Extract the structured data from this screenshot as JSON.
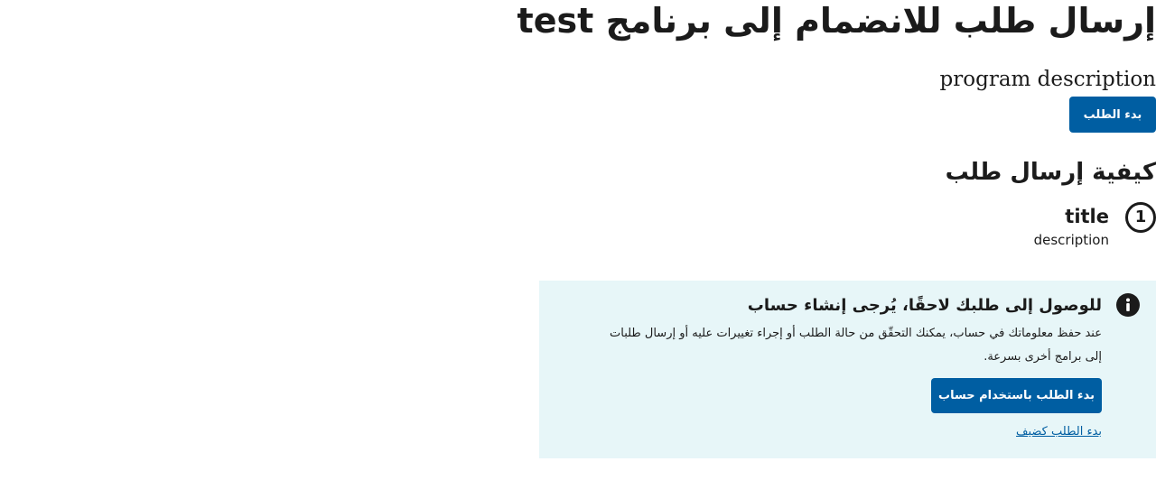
{
  "header": {
    "title": "إرسال طلب للانضمام إلى برنامج test",
    "program_description": "program description",
    "start_button_label": "بدء الطلب"
  },
  "how_to": {
    "heading": "كيفية إرسال طلب",
    "steps": [
      {
        "number": "1",
        "title": "title",
        "description": "description"
      }
    ]
  },
  "account_alert": {
    "icon": "info-icon",
    "heading": "للوصول إلى طلبك لاحقًا، يُرجى إنشاء حساب",
    "body": "عند حفظ معلوماتك في حساب، يمكنك التحقّق من حالة الطلب أو إجراء تغييرات عليه أو إرسال طلبات إلى برامج أخرى بسرعة.",
    "account_button_label": "بدء الطلب باستخدام حساب",
    "guest_link_label": "بدء الطلب كضيف"
  },
  "colors": {
    "primary": "#005ea2",
    "alert_background": "#e7f6f8",
    "text": "#1b1b1b"
  }
}
